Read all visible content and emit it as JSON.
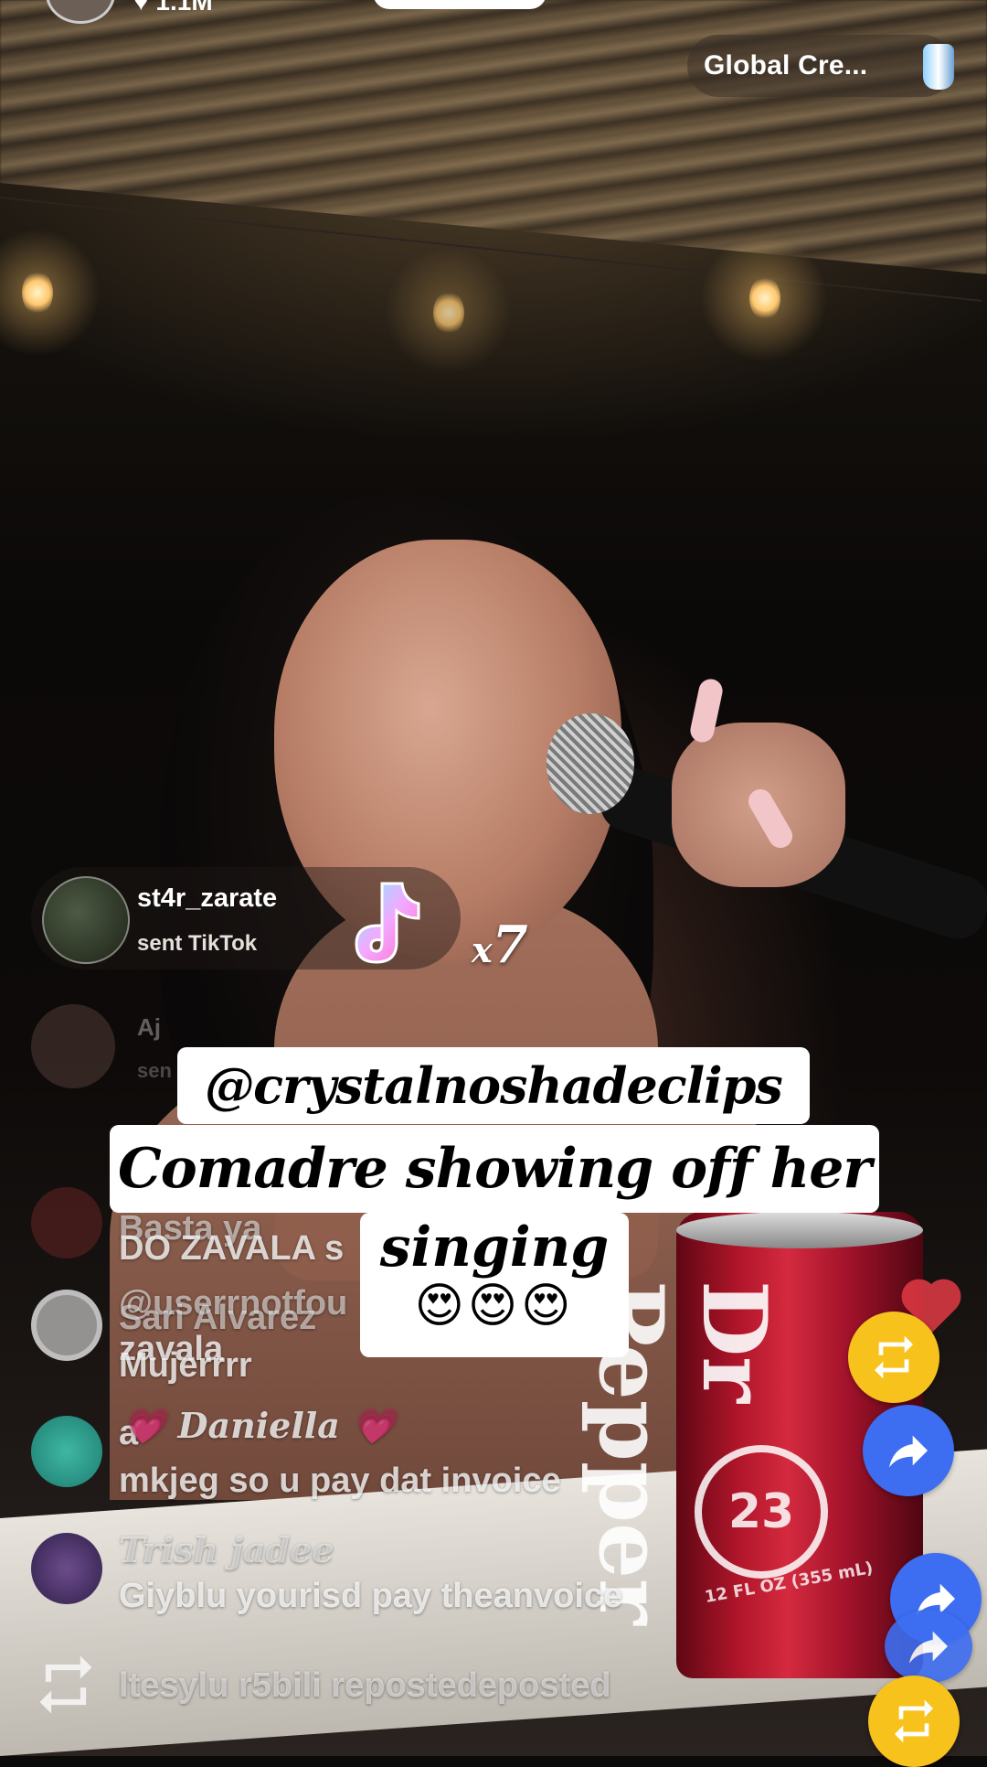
{
  "live": {
    "like_count": "1.1M",
    "ranking_label": "Global Cre...",
    "trophy_icon": "trophy-icon"
  },
  "gift": {
    "username": "st4r_zarate",
    "action": "sent TikTok",
    "gift_icon": "tiktok-music-note-gift-icon",
    "count_prefix": "x",
    "count": "7"
  },
  "ghost_gift": {
    "username": "Aj",
    "action": "sen"
  },
  "caption": {
    "handle": "@crystalnoshadeclips",
    "line1": "Comadre showing off her",
    "line2": "singing",
    "emojis": "😍😍😍"
  },
  "comments": [
    {
      "text": "Basta ya"
    },
    {
      "text": "DO ZAVALA s"
    },
    {
      "text": "@userrnotfou"
    },
    {
      "text": "Sari Alvarez"
    },
    {
      "text": "zavala"
    },
    {
      "text": "Mujerrrr"
    },
    {
      "text": "a"
    },
    {
      "text": "💗 Daniella 💗"
    },
    {
      "text": "mkjeg so u pay dat invoice"
    },
    {
      "text": "Trish jadee"
    },
    {
      "text": "Giyblu yourisd pay theanvoice"
    },
    {
      "text": "ltesylu r5bili repostedeposted"
    }
  ],
  "actions": {
    "repost_icon": "repost-icon",
    "share_icon": "share-arrow-icon"
  },
  "can": {
    "brand": "Dr Pepper",
    "badge": "23",
    "volume": "12 FL OZ (355 mL)"
  },
  "colors": {
    "repost_yellow": "#f7c21c",
    "share_blue": "#3d6df0",
    "caption_bg": "#ffffff"
  }
}
